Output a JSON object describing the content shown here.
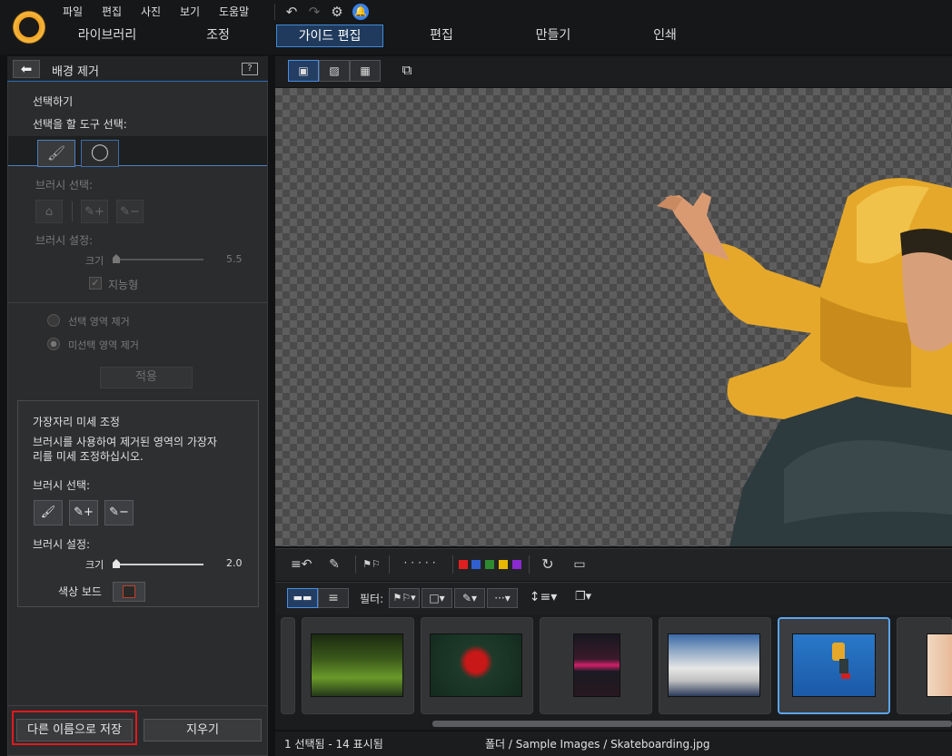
{
  "menu": [
    "파일",
    "편집",
    "사진",
    "보기",
    "도움말"
  ],
  "mode_tabs": [
    "라이브러리",
    "조정",
    "가이드 편집",
    "편집",
    "만들기",
    "인쇄"
  ],
  "panel": {
    "title": "배경 제거",
    "select_heading": "선택하기",
    "select_tool_label": "선택을 할 도구 선택:",
    "brush_select": "브러시 선택:",
    "brush_settings": "브러시 설정:",
    "size_label": "크기",
    "size_value": "5.5",
    "smart_label": "지능형",
    "radio_remove_selected": "선택 영역 제거",
    "radio_remove_unselected": "미선택 영역 제거",
    "apply": "적용",
    "edge": {
      "title": "가장자리 미세 조정",
      "desc_line1": "브러시를 사용하여 제거된 영역의 가장자",
      "desc_line2": "리를 미세 조정하십시오.",
      "brush_select": "브러시 선택:",
      "brush_settings": "브러시 설정:",
      "size_label": "크기",
      "size_value": "2.0",
      "color_board": "색상 보드"
    },
    "save_as": "다른 이름으로 저장",
    "clear": "지우기"
  },
  "filter_label": "필터:",
  "status": {
    "selection": "1 선택됨 - 14 표시됨",
    "path": "폴더 / Sample Images / Skateboarding.jpg"
  },
  "colors": {
    "accent": "#3f8ad8",
    "highlight": "#e0191e",
    "labels": [
      "#e02020",
      "#2f5fd0",
      "#2e8a2e",
      "#e8b800",
      "#8a2ad0"
    ]
  }
}
